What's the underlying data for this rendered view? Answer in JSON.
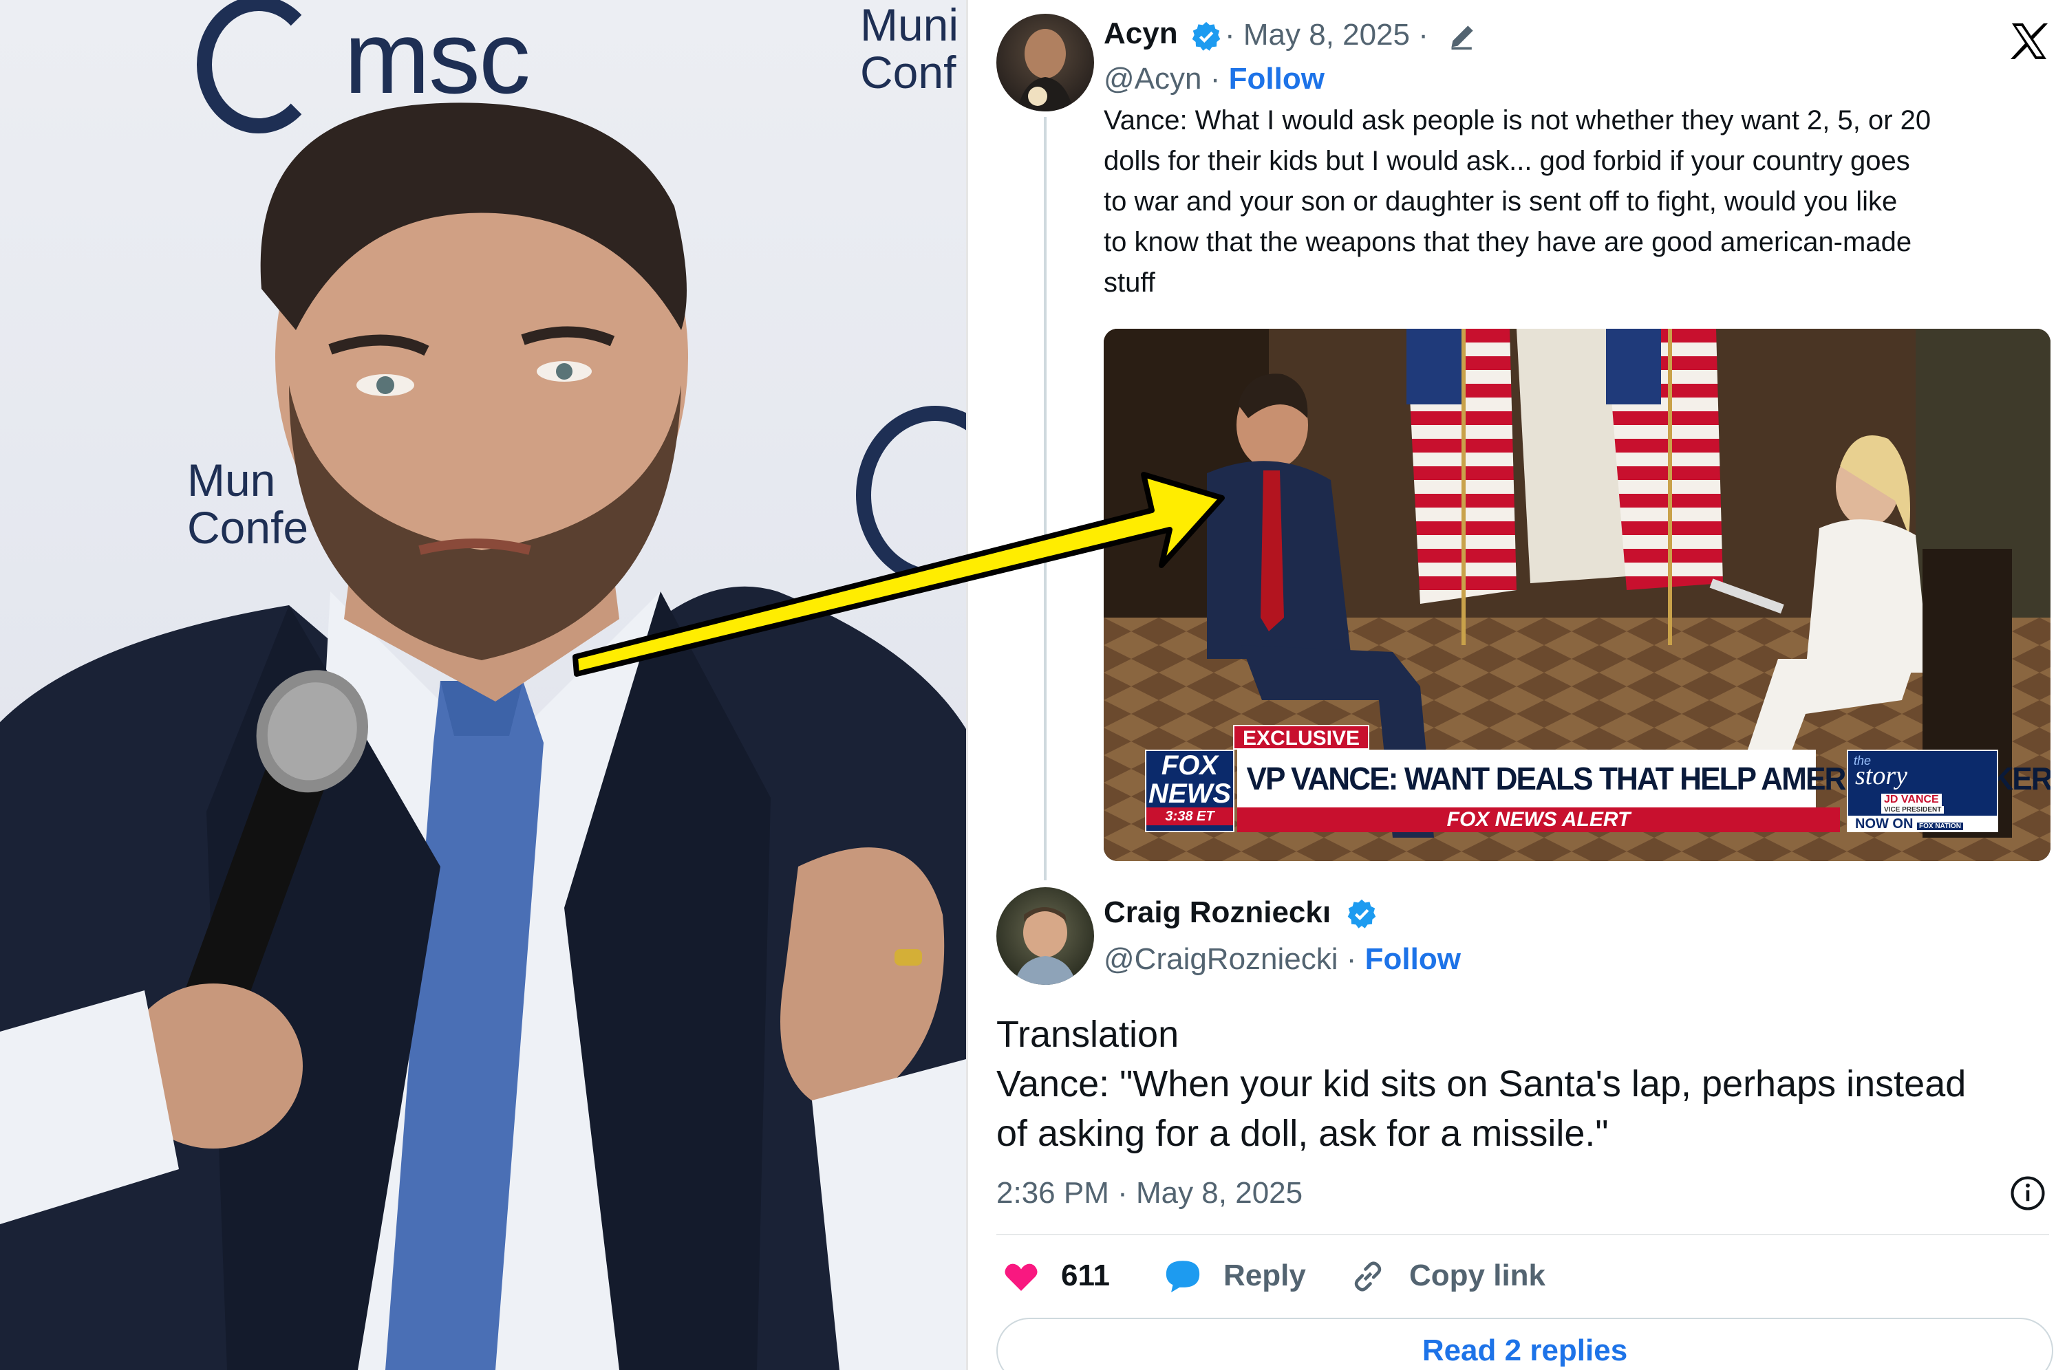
{
  "backdrop": {
    "logo_text": "msc",
    "conference_text_top_line1": "Muni",
    "conference_text_top_line2": "Conf",
    "conference_text_mid_line1": "Mun",
    "conference_text_mid_line2": "Confe"
  },
  "tweet1": {
    "name": "Acyn",
    "date": "· May 8, 2025 ·",
    "handle": "@Acyn ·",
    "follow_label": "Follow",
    "text_lines": [
      "Vance: What I would ask people is not whether they want 2, 5, or 20",
      "dolls for their kids but I would ask... god forbid if your country goes",
      "to war and your son or daughter is sent off to fight, would you like",
      "to know that the weapons that they have are good american-made",
      "stuff"
    ],
    "video": {
      "exclusive_label": "EXCLUSIVE",
      "headline": "VP VANCE: WANT DEALS THAT HELP AMERICAN WORKERS",
      "alert": "FOX NEWS ALERT",
      "network_line1": "FOX",
      "network_line2": "NEWS",
      "time": "3:38 ET",
      "show_name": "story",
      "show_the": "the",
      "guest_name": "JD VANCE",
      "guest_title": "VICE PRESIDENT",
      "now_on": "NOW ON",
      "nation": "FOX NATION"
    }
  },
  "tweet2": {
    "name": "Craig Roznieckı",
    "handle": "@CraigRozniecki ·",
    "follow_label": "Follow",
    "text_lines": [
      "Translation",
      "Vance: \"When your kid sits on Santa's lap, perhaps instead",
      "of asking for a doll, ask for a missile.\""
    ],
    "timestamp": "2:36 PM · May 8, 2025",
    "likes": "611",
    "reply_label": "Reply",
    "copy_link_label": "Copy link",
    "read_replies_label": "Read 2 replies"
  },
  "colors": {
    "accent_blue": "#1d73e8",
    "like_pink": "#f91880",
    "arrow_yellow": "#ffed00",
    "backdrop_navy": "#1e2f54"
  },
  "icons": [
    "verified-badge-icon",
    "edit-pencil-icon",
    "x-logo-icon",
    "heart-icon",
    "reply-bubble-icon",
    "link-icon",
    "info-icon"
  ]
}
